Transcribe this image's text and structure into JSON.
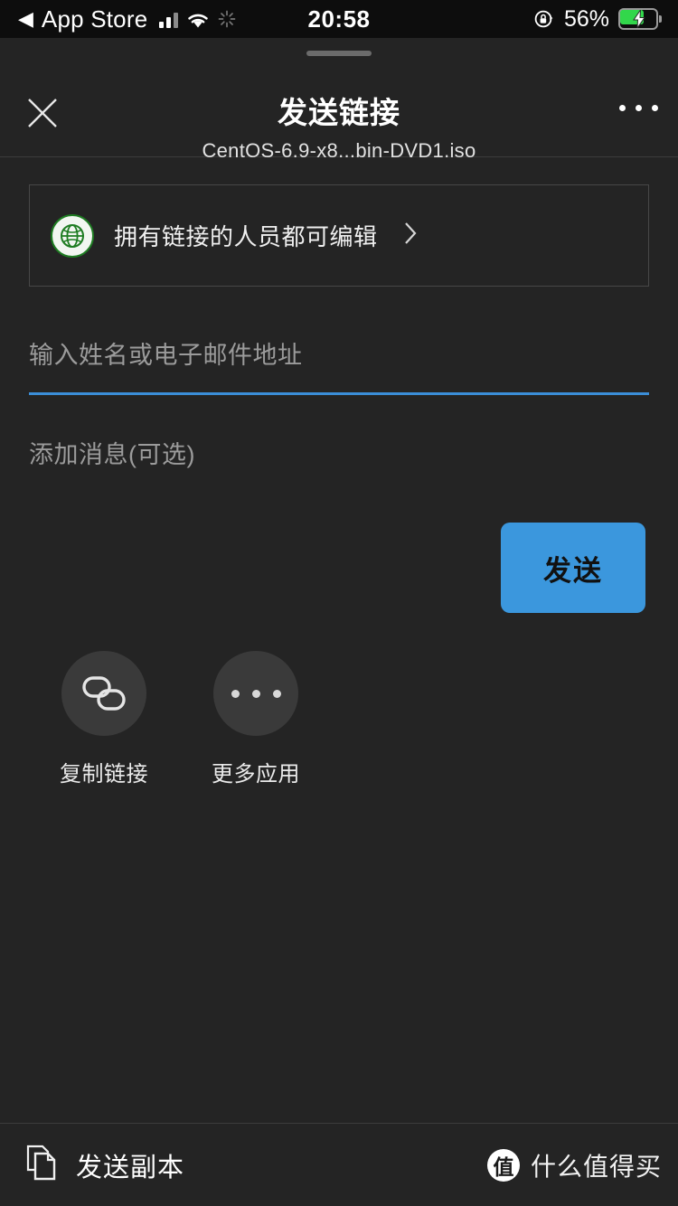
{
  "status_bar": {
    "back_label": "App Store",
    "time": "20:58",
    "battery_percent": "56%",
    "icons": {
      "back_arrow": "back-triangle-icon",
      "cellular": "cellular-bars-icon",
      "wifi": "wifi-icon",
      "activity": "activity-spinner-icon",
      "rotation_lock": "rotation-lock-icon",
      "battery": "battery-charging-icon"
    }
  },
  "header": {
    "title": "发送链接",
    "subtitle": "CentOS-6.9-x8...bin-DVD1.iso",
    "close_icon": "close-x-icon",
    "more_icon": "more-dots-icon",
    "grabber": "drag-handle"
  },
  "permission": {
    "label": "拥有链接的人员都可编辑",
    "icon": "globe-icon",
    "chevron": "chevron-right-icon",
    "accent_color": "#1e7c22"
  },
  "fields": {
    "recipients_placeholder": "输入姓名或电子邮件地址",
    "recipients_value": "",
    "message_placeholder": "添加消息(可选)",
    "message_value": "",
    "focus_underline_color": "#3b8ed8"
  },
  "send_button": {
    "label": "发送",
    "color": "#3b97dd"
  },
  "apps": [
    {
      "label": "复制链接",
      "icon": "chain-link-icon"
    },
    {
      "label": "更多应用",
      "icon": "more-dots-icon"
    }
  ],
  "bottom_bar": {
    "send_copy_label": "发送副本",
    "send_copy_icon": "duplicate-document-icon"
  },
  "watermark": {
    "badge": "值",
    "text": "什么值得买"
  }
}
